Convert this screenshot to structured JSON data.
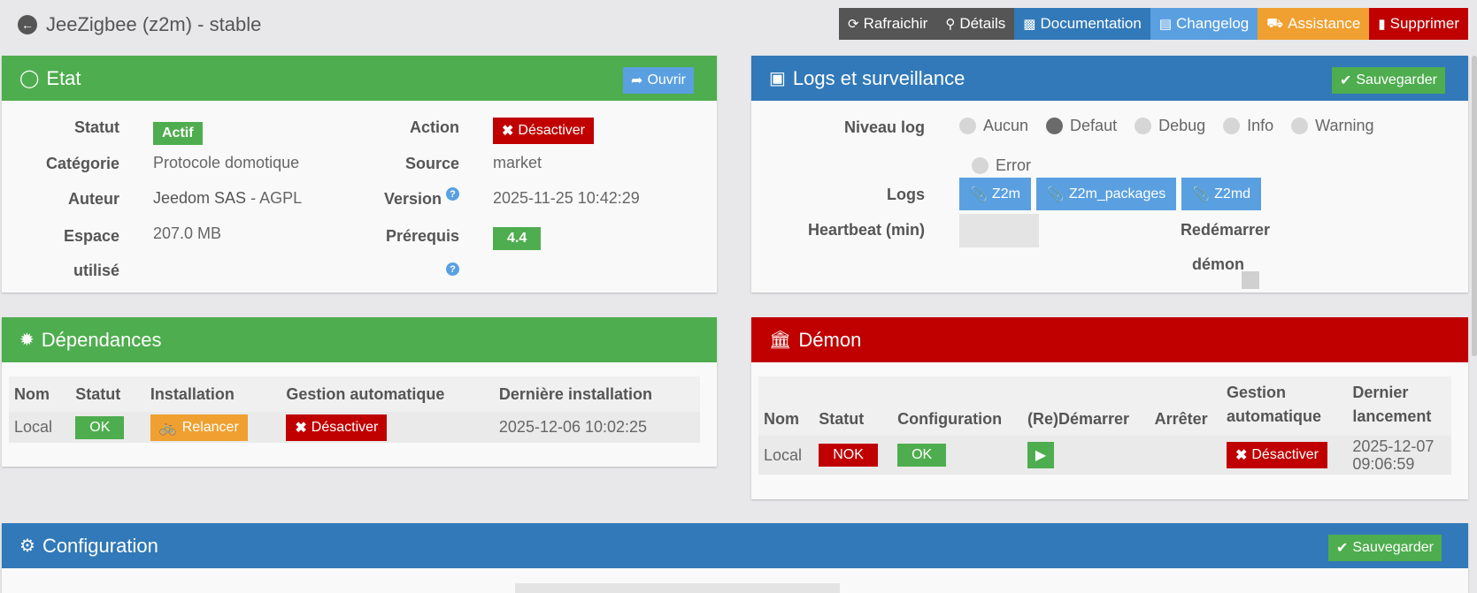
{
  "header": {
    "title": "JeeZigbee (z2m) - stable",
    "buttons": [
      {
        "label": "Rafraichir",
        "icon": "refresh-icon",
        "color": "#555555"
      },
      {
        "label": "Détails",
        "icon": "search-icon",
        "color": "#555555"
      },
      {
        "label": "Documentation",
        "icon": "book-icon",
        "color": "#3179b8"
      },
      {
        "label": "Changelog",
        "icon": "file-code-icon",
        "color": "#5aa0e0"
      },
      {
        "label": "Assistance",
        "icon": "ambulance-icon",
        "color": "#f0a030"
      },
      {
        "label": "Supprimer",
        "icon": "trash-icon",
        "color": "#c00000"
      }
    ]
  },
  "etat": {
    "title": "Etat",
    "open_label": "Ouvrir",
    "statut_label": "Statut",
    "statut_value": "Actif",
    "action_label": "Action",
    "action_value": "Désactiver",
    "categorie_label": "Catégorie",
    "categorie_value": "Protocole domotique",
    "source_label": "Source",
    "source_value": "market",
    "auteur_label": "Auteur",
    "auteur_name": "Jeedom SAS",
    "auteur_license": " - AGPL",
    "version_label": "Version",
    "version_value": "2025-11-25 10:42:29",
    "espace_label_1": "Espace",
    "espace_label_2": "utilisé",
    "espace_value": "207.0 MB",
    "prerequis_label": "Prérequis",
    "prerequis_value": "4.4"
  },
  "logs": {
    "title": "Logs et surveillance",
    "save_label": "Sauvegarder",
    "niveau_label": "Niveau log",
    "levels": [
      "Aucun",
      "Defaut",
      "Debug",
      "Info",
      "Warning",
      "Error"
    ],
    "selected_level": "Defaut",
    "logs_label": "Logs",
    "log_buttons": [
      "Z2m",
      "Z2m_packages",
      "Z2md"
    ],
    "heartbeat_label": "Heartbeat (min)",
    "heartbeat_value": "",
    "restart_label_1": "Redémarrer",
    "restart_label_2": "démon"
  },
  "dependances": {
    "title": "Dépendances",
    "headers": [
      "Nom",
      "Statut",
      "Installation",
      "Gestion automatique",
      "Dernière installation"
    ],
    "row": {
      "nom": "Local",
      "statut": "OK",
      "installation": "Relancer",
      "gestion": "Désactiver",
      "derniere": "2025-12-06 10:02:25"
    }
  },
  "demon": {
    "title": "Démon",
    "headers": {
      "nom": "Nom",
      "statut": "Statut",
      "configuration": "Configuration",
      "redemarrer": "(Re)Démarrer",
      "arreter": "Arrêter",
      "gestion_1": "Gestion",
      "gestion_2": "automatique",
      "dernier_1": "Dernier",
      "dernier_2": "lancement"
    },
    "row": {
      "nom": "Local",
      "statut": "NOK",
      "configuration": "OK",
      "gestion": "Désactiver",
      "dernier_1": "2025-12-07",
      "dernier_2": "09:06:59"
    }
  },
  "configuration": {
    "title": "Configuration",
    "save_label": "Sauvegarder"
  },
  "colors": {
    "green": "#4ead4e",
    "blue": "#3179b8",
    "red": "#c00000",
    "orange": "#f0a030",
    "light_blue": "#5aa0e0"
  }
}
